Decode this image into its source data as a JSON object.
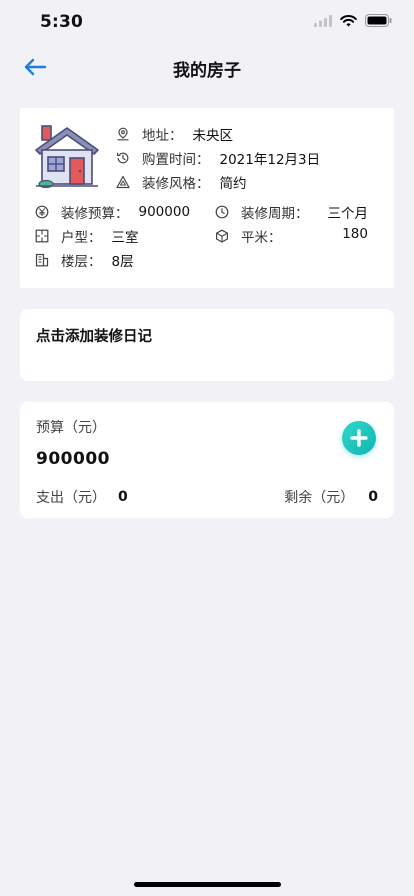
{
  "status_bar": {
    "time": "5:30"
  },
  "nav": {
    "title": "我的房子",
    "back_icon": "arrow-left-icon"
  },
  "house": {
    "address_label": "地址：",
    "address_value": "未央区",
    "purchase_time_label": "购置时间：",
    "purchase_time_value": "2021年12月3日",
    "style_label": "装修风格：",
    "style_value": "简约",
    "budget_label": "装修预算：",
    "budget_value": "900000",
    "period_label": "装修周期：",
    "period_value": "三个月",
    "layout_label": "户型：",
    "layout_value": "三室",
    "area_label": "平米：",
    "area_value": "180",
    "floor_label": "楼层：",
    "floor_value": "8层"
  },
  "diary": {
    "add_label": "点击添加装修日记"
  },
  "budget": {
    "label": "预算（元）",
    "amount": "900000",
    "expense_label": "支出（元）",
    "expense_value": "0",
    "remaining_label": "剩余（元）",
    "remaining_value": "0"
  },
  "colors": {
    "accent_blue": "#1a7fe0",
    "add_button": "#19c2be",
    "background": "#f2f1f6"
  }
}
